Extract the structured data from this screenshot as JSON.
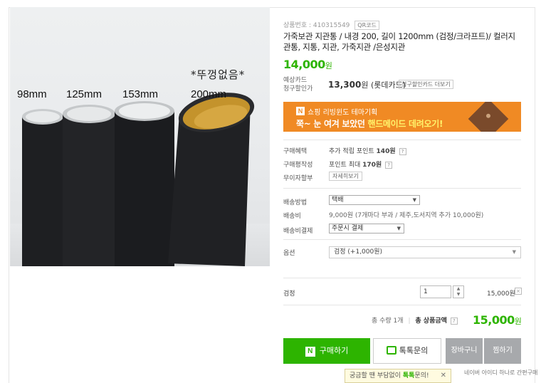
{
  "photo": {
    "note": "*뚜껑없음*",
    "sizes": [
      "98mm",
      "125mm",
      "153mm",
      "200mm"
    ]
  },
  "product": {
    "code_label": "상품번호 : 410315549",
    "qr_label": "QR코드",
    "title": "가죽보관 지관통 / 내경 200, 길이 1200mm (검정/크라프트)/ 컬러지관통, 지통, 지관, 가죽지관 /은성지관",
    "price": "14,000",
    "price_unit": "원",
    "card_label_1": "예상카드",
    "card_label_2": "청구할인가",
    "card_price": "13,300",
    "card_price_unit": "원",
    "card_name": "(롯데카드)",
    "card_button": "청구할인카드 더보기"
  },
  "banner": {
    "logo": "N",
    "line1": "쇼핑 리빙윈도 테마기획",
    "line2_pre": "쭉~ 눈 여겨 보았던 ",
    "line2_hl": "핸드메이드 데려오기!"
  },
  "benefits": {
    "purchase_label": "구매혜택",
    "purchase_value_pre": "추가 적립 포인트 ",
    "purchase_value_bold": "140원",
    "review_label": "구매평작성",
    "review_value_pre": "포인트 최대 ",
    "review_value_bold": "170원",
    "installment_label": "무이자할부",
    "installment_button": "자세히보기",
    "help_icon": "?"
  },
  "shipping": {
    "method_label": "배송방법",
    "method_value": "택배",
    "fee_label": "배송비",
    "fee_value": "9,000원 (7개마다 부과 / 제주,도서지역 추가 10,000원)",
    "payment_label": "배송비결제",
    "payment_value": "주문시 결제"
  },
  "option": {
    "label": "옵션",
    "value": "검정 (+1,000원)"
  },
  "selected": {
    "name": "검정",
    "quantity": "1",
    "price": "15,000원",
    "remove": "×"
  },
  "total": {
    "qty_text": "총 수량 1개",
    "label": "총 상품금액",
    "amount": "15,000",
    "unit": "원"
  },
  "buttons": {
    "buy": "구매하기",
    "buy_logo": "N",
    "talk": "톡톡문의",
    "cart": "장바구니",
    "wish": "찜하기"
  },
  "tooltip": {
    "pre": "궁금할 땐 부담없이 ",
    "green": "톡톡",
    "post": "문의!",
    "close": "✕"
  },
  "footer_note": "네이버 아이디 하나로 간편구매",
  "colors": {
    "accent_green": "#2db400",
    "banner_orange": "#f08a24",
    "grey_button": "#a7a9ac"
  }
}
